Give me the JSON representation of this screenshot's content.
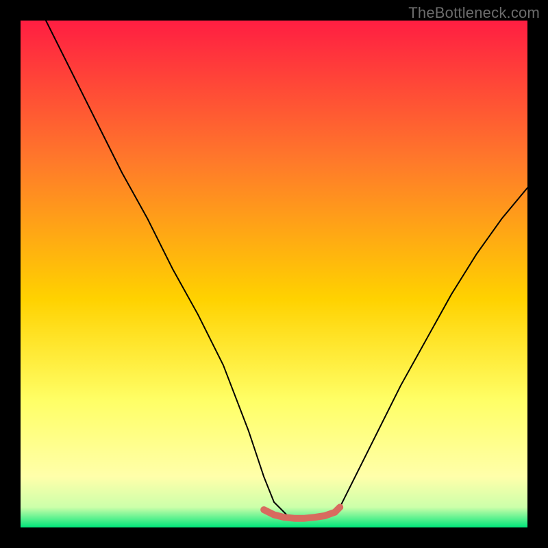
{
  "watermark": "TheBottleneck.com",
  "colors": {
    "bg": "#000000",
    "curve": "#000000",
    "marker": "#d86b5f",
    "grad_top": "#ff1e42",
    "grad_mid1": "#ff7a2a",
    "grad_mid2": "#ffd200",
    "grad_mid3": "#ffff66",
    "grad_low1": "#ffffaa",
    "grad_low2": "#ccffaa",
    "grad_bottom": "#00e67a"
  },
  "chart_data": {
    "type": "line",
    "title": "",
    "xlabel": "",
    "ylabel": "",
    "xlim": [
      0,
      100
    ],
    "ylim": [
      0,
      100
    ],
    "series": [
      {
        "name": "curve",
        "x": [
          5,
          10,
          15,
          20,
          25,
          30,
          35,
          40,
          45,
          48,
          50,
          53,
          55,
          58,
          60,
          63,
          65,
          70,
          75,
          80,
          85,
          90,
          95,
          100
        ],
        "y": [
          100,
          90,
          80,
          70,
          61,
          51,
          42,
          32,
          19,
          10,
          5,
          2,
          1.5,
          1.5,
          2,
          4,
          8,
          18,
          28,
          37,
          46,
          54,
          61,
          67
        ]
      },
      {
        "name": "flat-marker",
        "x": [
          48,
          50,
          52,
          54,
          56,
          58,
          60,
          62,
          63
        ],
        "y": [
          3.5,
          2.5,
          2.0,
          1.8,
          1.8,
          2.0,
          2.3,
          3.0,
          4.0
        ]
      }
    ]
  }
}
